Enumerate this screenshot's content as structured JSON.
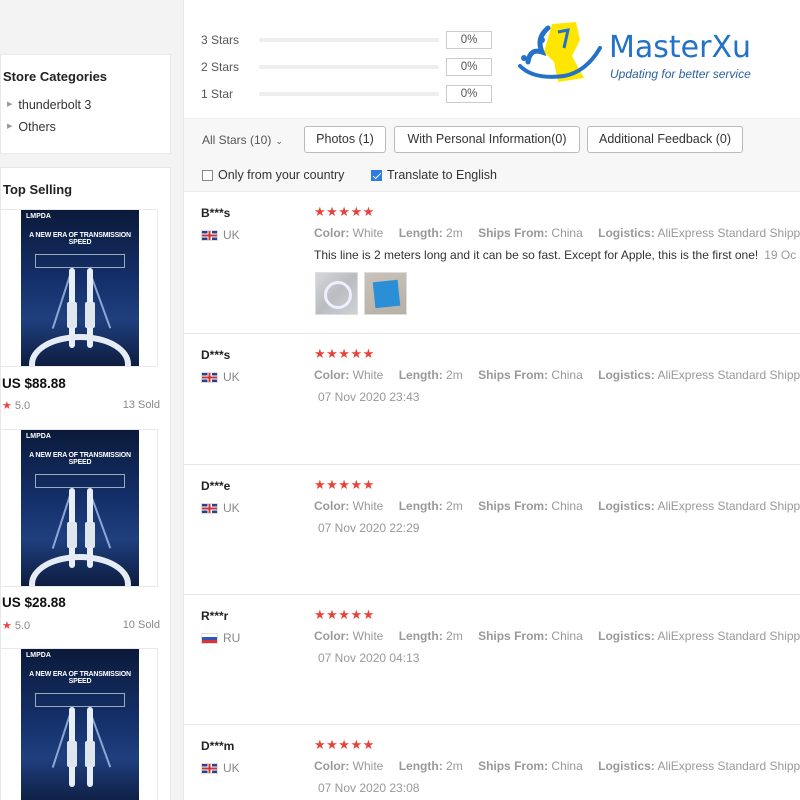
{
  "sidebar": {
    "categories": {
      "title": "Store Categories",
      "items": [
        {
          "label": "thunderbolt 3"
        },
        {
          "label": "Others"
        }
      ]
    },
    "top_selling": {
      "title": "Top Selling",
      "products": [
        {
          "brand": "LMPDA",
          "headline": "A NEW ERA OF TRANSMISSION SPEED",
          "price": "US $88.88",
          "rating": "5.0",
          "sold": "13 Sold"
        },
        {
          "brand": "LMPDA",
          "headline": "A NEW ERA OF TRANSMISSION SPEED",
          "price": "US $28.88",
          "rating": "5.0",
          "sold": "10 Sold"
        },
        {
          "brand": "LMPDA",
          "headline": "A NEW ERA OF TRANSMISSION SPEED"
        }
      ]
    }
  },
  "rating_distribution": [
    {
      "label": "3 Stars",
      "percent": "0%"
    },
    {
      "label": "2 Stars",
      "percent": "0%"
    },
    {
      "label": "1 Star",
      "percent": "0%"
    }
  ],
  "watermark": {
    "title": "MasterXu",
    "subtitle": "Updating for better service",
    "colors": {
      "primary": "#2472c8",
      "accent": "#ffe600"
    }
  },
  "filters": {
    "all_stars": "All Stars (10)",
    "buttons": [
      {
        "label": "Photos (1)"
      },
      {
        "label": "With Personal Information(0)"
      },
      {
        "label": "Additional Feedback (0)"
      }
    ],
    "only_country": {
      "label": "Only from your country",
      "checked": false
    },
    "translate": {
      "label": "Translate to English",
      "checked": true
    }
  },
  "attr_labels": {
    "color": "Color:",
    "length": "Length:",
    "ships_from": "Ships From:",
    "logistics": "Logistics:"
  },
  "reviews": [
    {
      "name": "B***s",
      "country": "UK",
      "stars": "★★★★★",
      "color": "White",
      "length": "2m",
      "ships_from": "China",
      "logistics": "AliExpress Standard Shipping",
      "text": "This line is 2 meters long and it can be so fast. Except for Apple, this is the first one!",
      "date": "19 Oc"
    },
    {
      "name": "D***s",
      "country": "UK",
      "stars": "★★★★★",
      "color": "White",
      "length": "2m",
      "ships_from": "China",
      "logistics": "AliExpress Standard Shipping",
      "date": "07 Nov 2020 23:43"
    },
    {
      "name": "D***e",
      "country": "UK",
      "stars": "★★★★★",
      "color": "White",
      "length": "2m",
      "ships_from": "China",
      "logistics": "AliExpress Standard Shipping",
      "date": "07 Nov 2020 22:29"
    },
    {
      "name": "R***r",
      "country": "RU",
      "stars": "★★★★★",
      "color": "White",
      "length": "2m",
      "ships_from": "China",
      "logistics": "AliExpress Standard Shipping",
      "date": "07 Nov 2020 04:13"
    },
    {
      "name": "D***m",
      "country": "UK",
      "stars": "★★★★★",
      "color": "White",
      "length": "2m",
      "ships_from": "China",
      "logistics": "AliExpress Standard Shipping",
      "date": "07 Nov 2020 23:08"
    }
  ],
  "colors": {
    "star_red": "#e9423a",
    "checkbox_blue": "#2d7be5"
  }
}
